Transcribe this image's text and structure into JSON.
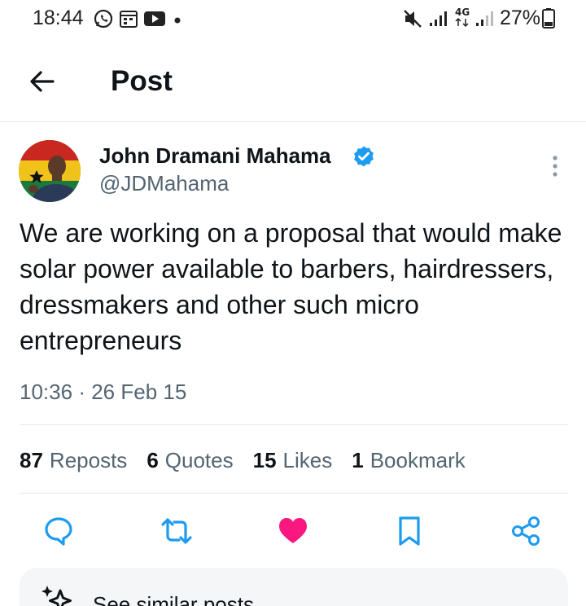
{
  "status_bar": {
    "time": "18:44",
    "network_type": "4G",
    "battery": "27%",
    "icons": [
      "whatsapp-icon",
      "calendar-icon",
      "youtube-icon",
      "dot-icon",
      "mute-icon",
      "signal-icon",
      "signal-icon",
      "battery-icon"
    ]
  },
  "header": {
    "title": "Post",
    "back_icon": "arrow-left-icon"
  },
  "post": {
    "author_name": "John Dramani Mahama",
    "author_handle": "@JDMahama",
    "verified": true,
    "text": "We are working on a proposal that would make solar power available to barbers, hairdressers, dressmakers and other such micro entrepreneurs",
    "time": "10:36",
    "separator": "·",
    "date": "26 Feb 15",
    "more_icon": "more-vertical-icon"
  },
  "stats": {
    "reposts": {
      "count": "87",
      "label": "Reposts"
    },
    "quotes": {
      "count": "6",
      "label": "Quotes"
    },
    "likes": {
      "count": "15",
      "label": "Likes"
    },
    "bookmarks": {
      "count": "1",
      "label": "Bookmark"
    }
  },
  "actions": [
    {
      "name": "reply",
      "icon": "comment-icon"
    },
    {
      "name": "repost",
      "icon": "repost-icon"
    },
    {
      "name": "like",
      "icon": "heart-icon",
      "active": true
    },
    {
      "name": "bookmark",
      "icon": "bookmark-icon"
    },
    {
      "name": "share",
      "icon": "share-icon"
    }
  ],
  "similar": {
    "label": "See similar posts",
    "icon": "sparkle-icon"
  },
  "colors": {
    "text_primary": "#0f1419",
    "text_secondary": "#536471",
    "accent_blue": "#1d9bf0",
    "like_pink": "#f91880",
    "divider": "#e6e9ec"
  }
}
